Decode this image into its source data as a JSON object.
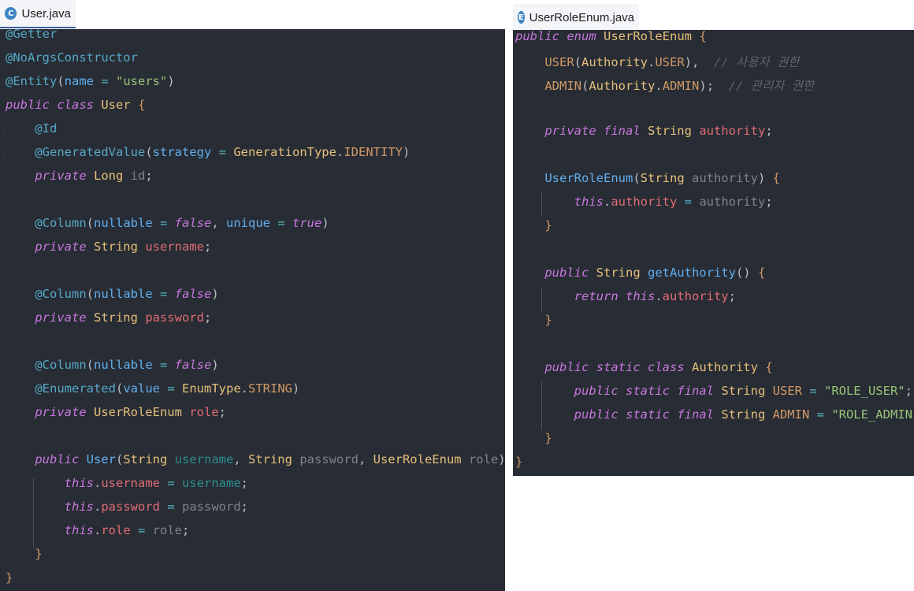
{
  "left_tab": {
    "icon": "C",
    "label": "User.java"
  },
  "right_tab": {
    "icon": "E",
    "label": "UserRoleEnum.java"
  },
  "left_lines": [
    [
      [
        "@Getter",
        "an"
      ]
    ],
    [
      [
        "@NoArgsConstructor",
        "an"
      ]
    ],
    [
      [
        "@Entity",
        "an"
      ],
      [
        "(",
        "pu"
      ],
      [
        "name ",
        "fn"
      ],
      [
        "= ",
        "op"
      ],
      [
        "\"users\"",
        "st"
      ],
      [
        ")",
        "pu"
      ]
    ],
    [
      [
        "public ",
        "kw"
      ],
      [
        "class ",
        "kw"
      ],
      [
        "User ",
        "ty"
      ],
      [
        "{",
        "br"
      ]
    ],
    [
      [
        "    ",
        "pu"
      ],
      [
        "@Id",
        "an"
      ]
    ],
    [
      [
        "    ",
        "pu"
      ],
      [
        "@GeneratedValue",
        "an"
      ],
      [
        "(",
        "pu"
      ],
      [
        "strategy ",
        "fn"
      ],
      [
        "= ",
        "op"
      ],
      [
        "GenerationType",
        "ty"
      ],
      [
        ".",
        "pu"
      ],
      [
        "IDENTITY",
        "cst"
      ],
      [
        ")",
        "pu"
      ]
    ],
    [
      [
        "    ",
        "pu"
      ],
      [
        "private ",
        "kw"
      ],
      [
        "Long ",
        "ty"
      ],
      [
        "id",
        "pa"
      ],
      [
        ";",
        "pu"
      ]
    ],
    [],
    [
      [
        "    ",
        "pu"
      ],
      [
        "@Column",
        "an"
      ],
      [
        "(",
        "pu"
      ],
      [
        "nullable ",
        "fn"
      ],
      [
        "= ",
        "op"
      ],
      [
        "false",
        "kw"
      ],
      [
        ", ",
        "pu"
      ],
      [
        "unique ",
        "fn"
      ],
      [
        "= ",
        "op"
      ],
      [
        "true",
        "kw"
      ],
      [
        ")",
        "pu"
      ]
    ],
    [
      [
        "    ",
        "pu"
      ],
      [
        "private ",
        "kw"
      ],
      [
        "String ",
        "ty"
      ],
      [
        "username",
        "fi"
      ],
      [
        ";",
        "pu"
      ]
    ],
    [],
    [
      [
        "    ",
        "pu"
      ],
      [
        "@Column",
        "an"
      ],
      [
        "(",
        "pu"
      ],
      [
        "nullable ",
        "fn"
      ],
      [
        "= ",
        "op"
      ],
      [
        "false",
        "kw"
      ],
      [
        ")",
        "pu"
      ]
    ],
    [
      [
        "    ",
        "pu"
      ],
      [
        "private ",
        "kw"
      ],
      [
        "String ",
        "ty"
      ],
      [
        "password",
        "fi"
      ],
      [
        ";",
        "pu"
      ]
    ],
    [],
    [
      [
        "    ",
        "pu"
      ],
      [
        "@Column",
        "an"
      ],
      [
        "(",
        "pu"
      ],
      [
        "nullable ",
        "fn"
      ],
      [
        "= ",
        "op"
      ],
      [
        "false",
        "kw"
      ],
      [
        ")",
        "pu"
      ]
    ],
    [
      [
        "    ",
        "pu"
      ],
      [
        "@Enumerated",
        "an"
      ],
      [
        "(",
        "pu"
      ],
      [
        "value ",
        "fn"
      ],
      [
        "= ",
        "op"
      ],
      [
        "EnumType",
        "ty"
      ],
      [
        ".",
        "pu"
      ],
      [
        "STRING",
        "cst"
      ],
      [
        ")",
        "pu"
      ]
    ],
    [
      [
        "    ",
        "pu"
      ],
      [
        "private ",
        "kw"
      ],
      [
        "UserRoleEnum ",
        "ty"
      ],
      [
        "role",
        "fi"
      ],
      [
        ";",
        "pu"
      ]
    ],
    [],
    [
      [
        "    ",
        "pu"
      ],
      [
        "public ",
        "kw"
      ],
      [
        "User",
        "fn"
      ],
      [
        "(",
        "pu"
      ],
      [
        "String ",
        "ty"
      ],
      [
        "username",
        "pmu"
      ],
      [
        ", ",
        "pu"
      ],
      [
        "String ",
        "ty"
      ],
      [
        "password",
        "pa"
      ],
      [
        ", ",
        "pu"
      ],
      [
        "UserRoleEnum ",
        "ty"
      ],
      [
        "role",
        "pa"
      ],
      [
        ") ",
        "pu"
      ],
      [
        "{",
        "br"
      ]
    ],
    [
      [
        "        ",
        "pu"
      ],
      [
        "this",
        "kw"
      ],
      [
        ".",
        "pu"
      ],
      [
        "username ",
        "fi"
      ],
      [
        "= ",
        "op"
      ],
      [
        "username",
        "pmu"
      ],
      [
        ";",
        "pu"
      ]
    ],
    [
      [
        "        ",
        "pu"
      ],
      [
        "this",
        "kw"
      ],
      [
        ".",
        "pu"
      ],
      [
        "password ",
        "fi"
      ],
      [
        "= ",
        "op"
      ],
      [
        "password",
        "pa"
      ],
      [
        ";",
        "pu"
      ]
    ],
    [
      [
        "        ",
        "pu"
      ],
      [
        "this",
        "kw"
      ],
      [
        ".",
        "pu"
      ],
      [
        "role ",
        "fi"
      ],
      [
        "= ",
        "op"
      ],
      [
        "role",
        "pa"
      ],
      [
        ";",
        "pu"
      ]
    ],
    [
      [
        "    ",
        "pu"
      ],
      [
        "}",
        "br"
      ]
    ],
    [
      [
        "}",
        "br"
      ]
    ]
  ],
  "right_lines": [
    [
      [
        "public ",
        "kw"
      ],
      [
        "enum ",
        "kw"
      ],
      [
        "UserRoleEnum ",
        "ty"
      ],
      [
        "{",
        "br"
      ]
    ],
    [
      [
        "    ",
        "pu"
      ],
      [
        "USER",
        "cst"
      ],
      [
        "(",
        "pu"
      ],
      [
        "Authority",
        "ty"
      ],
      [
        ".",
        "pu"
      ],
      [
        "USER",
        "cst"
      ],
      [
        "),  ",
        "pu"
      ],
      [
        "// 사용자 권한",
        "ctd"
      ]
    ],
    [
      [
        "    ",
        "pu"
      ],
      [
        "ADMIN",
        "cst"
      ],
      [
        "(",
        "pu"
      ],
      [
        "Authority",
        "ty"
      ],
      [
        ".",
        "pu"
      ],
      [
        "ADMIN",
        "cst"
      ],
      [
        ");  ",
        "pu"
      ],
      [
        "// 관리자 권한",
        "ctd"
      ]
    ],
    [],
    [
      [
        "    ",
        "pu"
      ],
      [
        "private ",
        "kw"
      ],
      [
        "final ",
        "kw"
      ],
      [
        "String ",
        "ty"
      ],
      [
        "authority",
        "fi"
      ],
      [
        ";",
        "pu"
      ]
    ],
    [],
    [
      [
        "    ",
        "pu"
      ],
      [
        "UserRoleEnum",
        "fn"
      ],
      [
        "(",
        "pu"
      ],
      [
        "String ",
        "ty"
      ],
      [
        "authority",
        "pa"
      ],
      [
        ") ",
        "pu"
      ],
      [
        "{",
        "br"
      ]
    ],
    [
      [
        "        ",
        "pu"
      ],
      [
        "this",
        "kw"
      ],
      [
        ".",
        "pu"
      ],
      [
        "authority ",
        "fi"
      ],
      [
        "= ",
        "op"
      ],
      [
        "authority",
        "pa"
      ],
      [
        ";",
        "pu"
      ]
    ],
    [
      [
        "    ",
        "pu"
      ],
      [
        "}",
        "br"
      ]
    ],
    [],
    [
      [
        "    ",
        "pu"
      ],
      [
        "public ",
        "kw"
      ],
      [
        "String ",
        "ty"
      ],
      [
        "getAuthority",
        "fn"
      ],
      [
        "() ",
        "pu"
      ],
      [
        "{",
        "br"
      ]
    ],
    [
      [
        "        ",
        "pu"
      ],
      [
        "return ",
        "kw"
      ],
      [
        "this",
        "kw"
      ],
      [
        ".",
        "pu"
      ],
      [
        "authority",
        "fi"
      ],
      [
        ";",
        "pu"
      ]
    ],
    [
      [
        "    ",
        "pu"
      ],
      [
        "}",
        "br"
      ]
    ],
    [],
    [
      [
        "    ",
        "pu"
      ],
      [
        "public ",
        "kw"
      ],
      [
        "static ",
        "kw"
      ],
      [
        "class ",
        "kw"
      ],
      [
        "Authority ",
        "ty"
      ],
      [
        "{",
        "br"
      ]
    ],
    [
      [
        "        ",
        "pu"
      ],
      [
        "public ",
        "kw"
      ],
      [
        "static ",
        "kw"
      ],
      [
        "final ",
        "kw"
      ],
      [
        "String ",
        "ty"
      ],
      [
        "USER ",
        "cst"
      ],
      [
        "= ",
        "op"
      ],
      [
        "\"ROLE_USER\"",
        "st"
      ],
      [
        ";",
        "pu"
      ]
    ],
    [
      [
        "        ",
        "pu"
      ],
      [
        "public ",
        "kw"
      ],
      [
        "static ",
        "kw"
      ],
      [
        "final ",
        "kw"
      ],
      [
        "String ",
        "ty"
      ],
      [
        "ADMIN ",
        "cst"
      ],
      [
        "= ",
        "op"
      ],
      [
        "\"ROLE_ADMIN\"",
        "st"
      ],
      [
        ";",
        "pu"
      ]
    ],
    [
      [
        "    ",
        "pu"
      ],
      [
        "}",
        "br"
      ]
    ],
    [
      [
        "}",
        "br"
      ]
    ]
  ]
}
